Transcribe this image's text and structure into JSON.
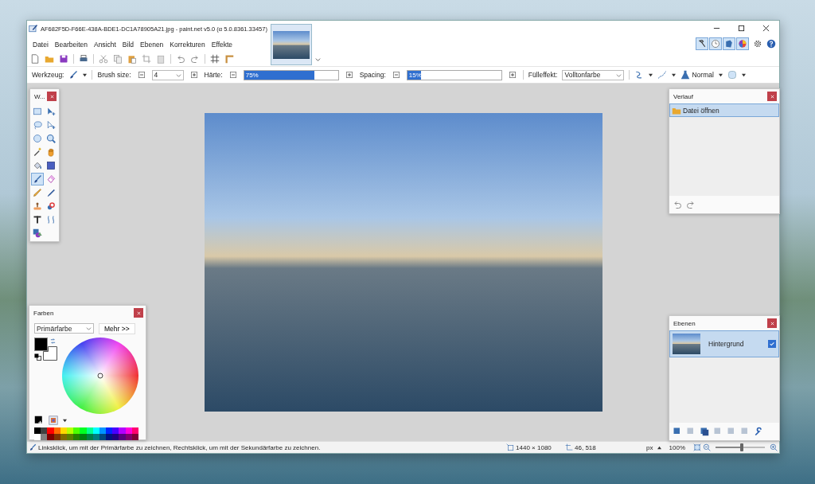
{
  "window": {
    "title": "AF682F5D-F66E-438A-BDE1-DC1A78905A21.jpg - paint.net v5.0 (α 5.0.8361.33457)"
  },
  "menu": [
    "Datei",
    "Bearbeiten",
    "Ansicht",
    "Bild",
    "Ebenen",
    "Korrekturen",
    "Effekte"
  ],
  "panel_toggles": [
    {
      "selected": true
    },
    {
      "selected": true
    },
    {
      "selected": true
    },
    {
      "selected": true
    }
  ],
  "tool_options": {
    "tool_label": "Werkzeug:",
    "brush_size_label": "Brush size:",
    "brush_size": "4",
    "hardness_label": "Härte:",
    "hardness": {
      "reading": "75%",
      "level": 0.75
    },
    "spacing_label": "Spacing:",
    "spacing": {
      "reading": "15%",
      "level": 0.15
    },
    "fill_label": "Fülleffekt:",
    "fill": "Volltonfarbe",
    "blend_mode": "Normal"
  },
  "tools_panel": {
    "title": "W...",
    "tools": [
      {
        "selected": false
      },
      {
        "selected": false
      },
      {
        "selected": false
      },
      {
        "selected": false
      },
      {
        "selected": false
      },
      {
        "selected": false
      },
      {
        "selected": false
      },
      {
        "selected": false
      },
      {
        "selected": false
      },
      {
        "selected": false
      },
      {
        "selected": true
      },
      {
        "selected": false
      },
      {
        "selected": false
      },
      {
        "selected": false
      },
      {
        "selected": false
      },
      {
        "selected": false
      },
      {
        "selected": false
      },
      {
        "selected": false
      },
      {
        "selected": false
      }
    ]
  },
  "colors_panel": {
    "title": "Farben",
    "target": "Primärfarbe",
    "more_button": "Mehr >>",
    "palette": [
      {
        "color": "#000000"
      },
      {
        "color": "#404040"
      },
      {
        "color": "#ff0000"
      },
      {
        "color": "#ff6a00"
      },
      {
        "color": "#ffd800"
      },
      {
        "color": "#b6ff00"
      },
      {
        "color": "#4cff00"
      },
      {
        "color": "#00ff21"
      },
      {
        "color": "#00ff90"
      },
      {
        "color": "#00ffff"
      },
      {
        "color": "#0094ff"
      },
      {
        "color": "#0026ff"
      },
      {
        "color": "#4800ff"
      },
      {
        "color": "#b200ff"
      },
      {
        "color": "#ff00dc"
      },
      {
        "color": "#ff006e"
      },
      {
        "color": "#ffffff"
      },
      {
        "color": "#808080"
      },
      {
        "color": "#7f0000"
      },
      {
        "color": "#7f3300"
      },
      {
        "color": "#7f6a00"
      },
      {
        "color": "#5b7f00"
      },
      {
        "color": "#267f00"
      },
      {
        "color": "#007f0e"
      },
      {
        "color": "#007f46"
      },
      {
        "color": "#007f7f"
      },
      {
        "color": "#004a7f"
      },
      {
        "color": "#00137f"
      },
      {
        "color": "#21007f"
      },
      {
        "color": "#57007f"
      },
      {
        "color": "#7f006e"
      },
      {
        "color": "#7f0037"
      }
    ]
  },
  "history_panel": {
    "title": "Verlauf",
    "items": [
      {
        "label": "Datei öffnen",
        "selected": true
      }
    ]
  },
  "layers_panel": {
    "title": "Ebenen",
    "layers": [
      {
        "name": "Hintergrund",
        "selected": true,
        "visible": true
      }
    ]
  },
  "status_bar": {
    "hint": "Linksklick, um mit der Primärfarbe zu zeichnen, Rechtsklick, um mit der Sekundärfarbe zu zeichnen.",
    "image_size": "1440 × 1080",
    "cursor_position": "46, 518",
    "unit": "px",
    "zoom": "100%",
    "zoom_slider": {
      "level": 0.5
    }
  }
}
